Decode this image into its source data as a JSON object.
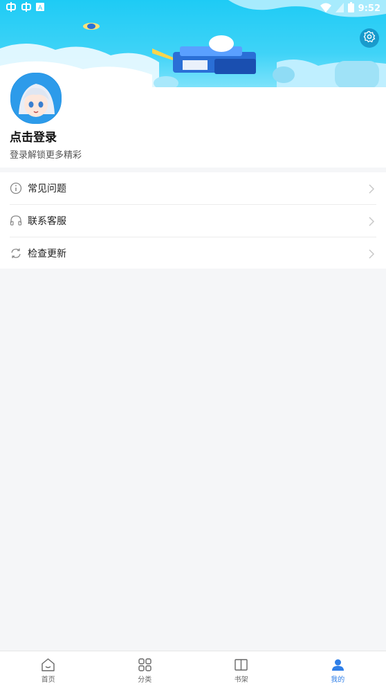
{
  "status_bar": {
    "time": "9:52",
    "left_icons": [
      "bug-icon",
      "bug-icon",
      "a-box-icon"
    ],
    "right_icons": [
      "wifi-icon",
      "signal-icon",
      "battery-icon"
    ]
  },
  "header": {
    "settings_icon": "gear-icon"
  },
  "profile": {
    "title": "点击登录",
    "subtitle": "登录解锁更多精彩"
  },
  "menu": {
    "items": [
      {
        "label": "常见问题",
        "icon": "info-icon"
      },
      {
        "label": "联系客服",
        "icon": "headset-icon"
      },
      {
        "label": "检查更新",
        "icon": "refresh-icon"
      }
    ]
  },
  "tabbar": {
    "tabs": [
      {
        "label": "首页",
        "icon": "home-icon"
      },
      {
        "label": "分类",
        "icon": "grid-icon"
      },
      {
        "label": "书架",
        "icon": "book-icon"
      },
      {
        "label": "我的",
        "icon": "user-icon"
      }
    ],
    "active_index": 3,
    "active_color": "#2f7fe8"
  },
  "colors": {
    "banner": "#1ecbf5",
    "background": "#f5f6f8"
  }
}
